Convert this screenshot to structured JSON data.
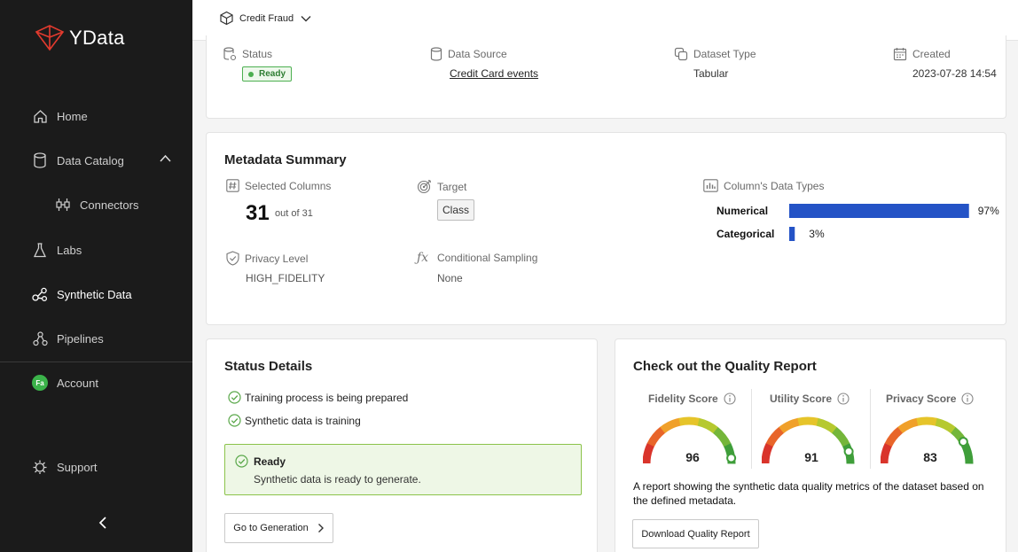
{
  "app": {
    "brand": "YData"
  },
  "sidebar": {
    "items": [
      {
        "label": "Home"
      },
      {
        "label": "Data Catalog"
      },
      {
        "label": "Connectors"
      },
      {
        "label": "Labs"
      },
      {
        "label": "Synthetic Data"
      },
      {
        "label": "Pipelines"
      },
      {
        "label": "Account",
        "avatar": "Fa"
      },
      {
        "label": "Support"
      }
    ]
  },
  "topbar": {
    "project": "Credit Fraud"
  },
  "overview": {
    "status_label": "Status",
    "status_value": "Ready",
    "source_label": "Data Source",
    "source_value": "Credit Card events",
    "type_label": "Dataset Type",
    "type_value": "Tabular",
    "created_label": "Created",
    "created_value": "2023-07-28 14:54"
  },
  "metadata": {
    "title": "Metadata Summary",
    "selected_label": "Selected Columns",
    "selected_count": "31",
    "selected_of": "out of 31",
    "target_label": "Target",
    "target_value": "Class",
    "types_label": "Column's Data Types",
    "privacy_label": "Privacy Level",
    "privacy_value": "HIGH_FIDELITY",
    "conditional_label": "Conditional Sampling",
    "conditional_value": "None"
  },
  "chart_data": {
    "type": "bar",
    "orientation": "horizontal",
    "categories": [
      "Numerical",
      "Categorical"
    ],
    "values": [
      97,
      3
    ],
    "value_labels": [
      "97%",
      "3%"
    ],
    "xlim": [
      0,
      100
    ],
    "color": "#2453c6"
  },
  "status_details": {
    "title": "Status Details",
    "steps": [
      "Training process is being prepared",
      "Synthetic data is training"
    ],
    "ready_title": "Ready",
    "ready_text": "Synthetic data is ready to generate.",
    "button": "Go to Generation"
  },
  "quality": {
    "title": "Check out the Quality Report",
    "scores": [
      {
        "label": "Fidelity Score",
        "value": 96
      },
      {
        "label": "Utility Score",
        "value": 91
      },
      {
        "label": "Privacy Score",
        "value": 83
      }
    ],
    "description": "A report showing the synthetic data quality metrics of the dataset based on the defined metadata.",
    "button": "Download Quality Report"
  }
}
